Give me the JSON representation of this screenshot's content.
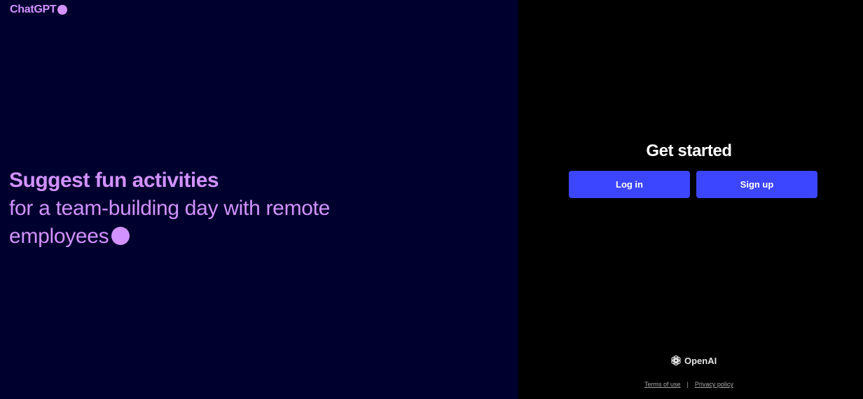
{
  "brand": {
    "name": "ChatGPT",
    "color": "#d292ff"
  },
  "hero": {
    "title": "Suggest fun activities",
    "subtitle_line1": "for a team-building day with remote",
    "subtitle_line2": "employees"
  },
  "auth": {
    "title": "Get started",
    "login_label": "Log in",
    "signup_label": "Sign up",
    "button_color": "#3c46ff"
  },
  "footer": {
    "company": "OpenAI",
    "logo_icon": "openai-logo-icon",
    "terms_label": "Terms of use",
    "separator": "|",
    "privacy_label": "Privacy policy"
  },
  "colors": {
    "left_background": "#00002e",
    "right_background": "#000000",
    "accent": "#d292ff"
  }
}
